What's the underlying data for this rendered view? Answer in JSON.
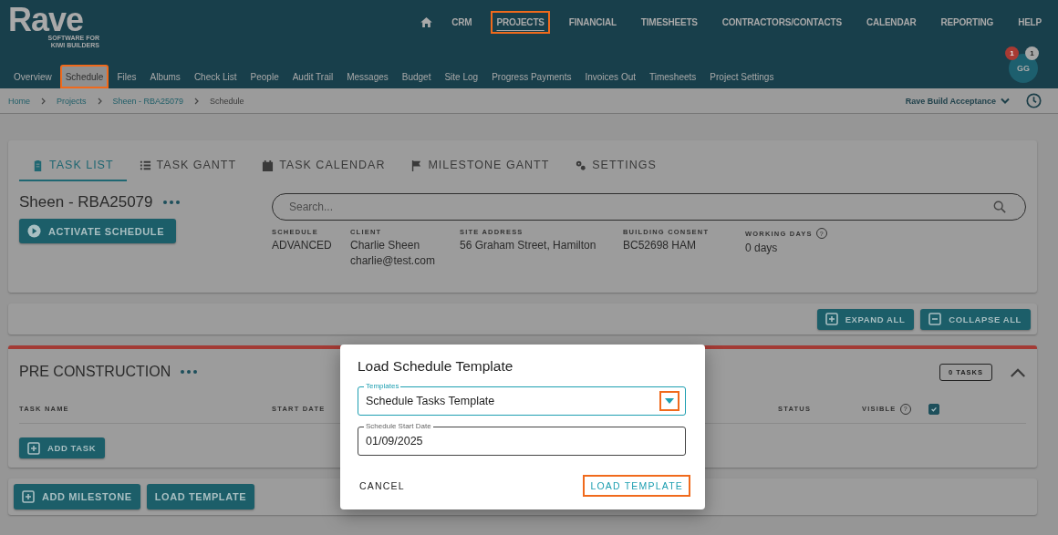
{
  "logo": {
    "name": "Rave",
    "tagline": [
      "SOFTWARE FOR",
      "KIWI BUILDERS"
    ]
  },
  "top_nav": [
    {
      "label": "CRM",
      "selected": false,
      "highlighted": false
    },
    {
      "label": "PROJECTS",
      "selected": true,
      "highlighted": true
    },
    {
      "label": "FINANCIAL",
      "selected": false,
      "highlighted": false
    },
    {
      "label": "TIMESHEETS",
      "selected": false,
      "highlighted": false
    },
    {
      "label": "CONTRACTORS/CONTACTS",
      "selected": false,
      "highlighted": false
    },
    {
      "label": "CALENDAR",
      "selected": false,
      "highlighted": false
    },
    {
      "label": "REPORTING",
      "selected": false,
      "highlighted": false
    },
    {
      "label": "HELP",
      "selected": false,
      "highlighted": false
    }
  ],
  "project_nav": [
    {
      "label": "Overview",
      "selected": false,
      "highlighted": false
    },
    {
      "label": "Schedule",
      "selected": true,
      "highlighted": true
    },
    {
      "label": "Files",
      "selected": false,
      "highlighted": false
    },
    {
      "label": "Albums",
      "selected": false,
      "highlighted": false
    },
    {
      "label": "Check List",
      "selected": false,
      "highlighted": false
    },
    {
      "label": "People",
      "selected": false,
      "highlighted": false
    },
    {
      "label": "Audit Trail",
      "selected": false,
      "highlighted": false
    },
    {
      "label": "Messages",
      "selected": false,
      "highlighted": false
    },
    {
      "label": "Budget",
      "selected": false,
      "highlighted": false
    },
    {
      "label": "Site Log",
      "selected": false,
      "highlighted": false
    },
    {
      "label": "Progress Payments",
      "selected": false,
      "highlighted": false
    },
    {
      "label": "Invoices Out",
      "selected": false,
      "highlighted": false
    },
    {
      "label": "Timesheets",
      "selected": false,
      "highlighted": false
    },
    {
      "label": "Project Settings",
      "selected": false,
      "highlighted": false
    }
  ],
  "user": {
    "initials": "GG",
    "badges": [
      {
        "count": "1",
        "color": "#a83a33"
      },
      {
        "count": "1",
        "color": "#a6a6a6"
      }
    ]
  },
  "breadcrumbs": [
    {
      "label": "Home",
      "current": false
    },
    {
      "label": "Projects",
      "current": false
    },
    {
      "label": "Sheen - RBA25079",
      "current": false
    },
    {
      "label": "Schedule",
      "current": true
    }
  ],
  "company": "Rave Build Acceptance",
  "view_tabs": [
    {
      "label": "TASK LIST",
      "kind": "clipboard",
      "selected": true
    },
    {
      "label": "TASK GANTT",
      "kind": "list",
      "selected": false
    },
    {
      "label": "TASK CALENDAR",
      "kind": "calendar",
      "selected": false
    },
    {
      "label": "MILESTONE GANTT",
      "kind": "flag",
      "selected": false
    },
    {
      "label": "SETTINGS",
      "kind": "gears",
      "selected": false
    }
  ],
  "project": {
    "title": "Sheen - RBA25079",
    "activate_button": "ACTIVATE SCHEDULE"
  },
  "search": {
    "placeholder": "Search..."
  },
  "details": [
    {
      "label": "SCHEDULE",
      "lines": [
        "ADVANCED"
      ]
    },
    {
      "label": "CLIENT",
      "lines": [
        "Charlie Sheen",
        "charlie@test.com"
      ]
    },
    {
      "label": "SITE ADDRESS",
      "lines": [
        "56 Graham Street, Hamilton"
      ]
    },
    {
      "label": "BUILDING CONSENT",
      "lines": [
        "BC52698 HAM"
      ]
    },
    {
      "label": "WORKING DAYS",
      "lines": [
        "0 days"
      ],
      "help": "?"
    }
  ],
  "toolbar_buttons": [
    {
      "label": "EXPAND ALL",
      "kind": "expand"
    },
    {
      "label": "COLLAPSE ALL",
      "kind": "collapse"
    }
  ],
  "stage": {
    "title": "PRE CONSTRUCTION",
    "task_count": "0 TASKS",
    "expanded": true,
    "columns": [
      {
        "label": "TASK NAME"
      },
      {
        "label": "START DATE"
      },
      {
        "label": "STATUS"
      },
      {
        "label": "VISIBLE",
        "help": "?"
      }
    ],
    "visible_checked": true,
    "add_task": "ADD TASK"
  },
  "footer_buttons": [
    {
      "label": "ADD MILESTONE",
      "kind": "add"
    },
    {
      "label": "LOAD TEMPLATE",
      "kind": "plain"
    }
  ],
  "dialog": {
    "title": "Load Schedule Template",
    "template_field": {
      "label": "Templates",
      "value": "Schedule Tasks Template",
      "focused": true,
      "dropdown_highlighted": true
    },
    "date_field": {
      "label": "Schedule Start Date",
      "value": "01/09/2025",
      "focused": false
    },
    "cancel": "CANCEL",
    "confirm": {
      "label": "LOAD TEMPLATE",
      "highlighted": true
    }
  }
}
